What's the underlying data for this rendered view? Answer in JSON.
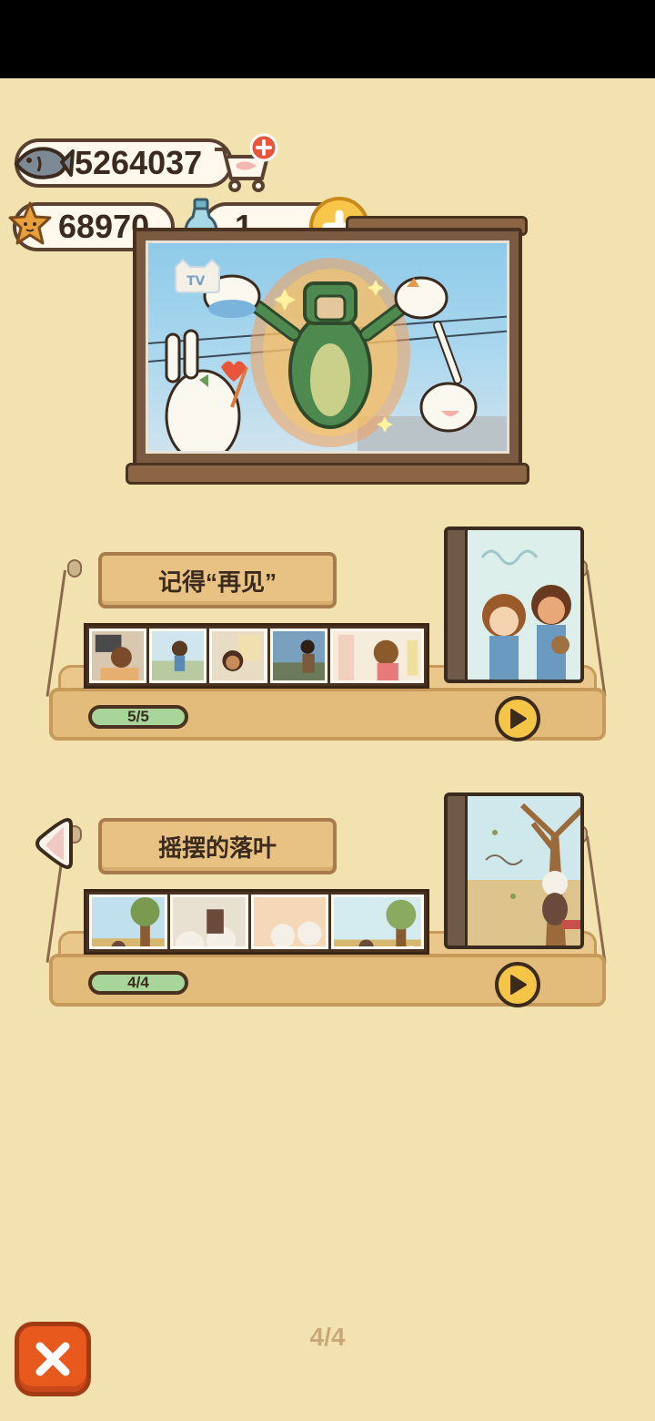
{
  "currencies": {
    "fish": "5264037",
    "stars": "68970",
    "bottles": "1"
  },
  "stories": [
    {
      "title": "记得“再见”",
      "progress": "5/5",
      "progress_fraction": 1.0
    },
    {
      "title": "摇摆的落叶",
      "progress": "4/4",
      "progress_fraction": 1.0
    }
  ],
  "tv_logo": "TV",
  "pagination": {
    "label": "4/4"
  },
  "icons": {
    "fish": "fish-icon",
    "cart": "cart-plus-icon",
    "star": "star-icon",
    "bottle": "bottle-icon",
    "plus": "plus-icon",
    "play": "play-icon",
    "close": "close-icon",
    "left_arrow": "left-arrow-icon"
  },
  "colors": {
    "background": "#f2e2b0",
    "close_button": "#e8591e",
    "play_button": "#f5c548",
    "progress_fill": "#a8d69a"
  }
}
